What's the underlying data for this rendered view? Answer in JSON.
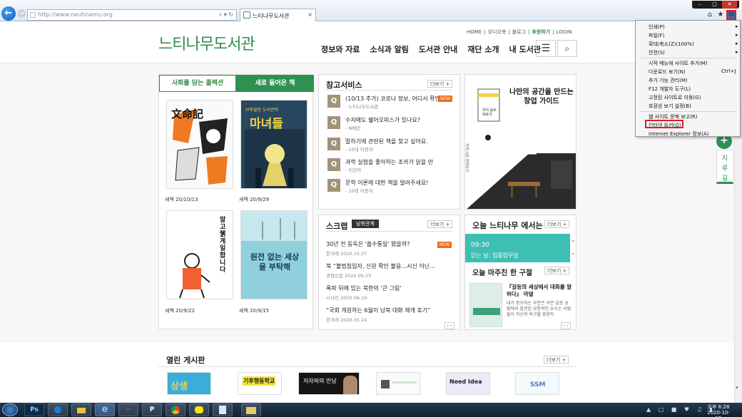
{
  "browser": {
    "url": "http://www.neutinamu.org",
    "address_controls": "⌕ ▾ ↻",
    "tab_title": "느티나무도서관",
    "tab_close": "×",
    "window_controls": {
      "min": "–",
      "max": "□",
      "close": "✕"
    },
    "home_icon": "⌂",
    "star_icon": "★",
    "gear_icon": "⚙"
  },
  "site": {
    "logo": "느티나무도서관",
    "util_links": [
      "HOME",
      "오디오북",
      "블로그",
      "후원하기",
      "LOGIN"
    ],
    "gnb": [
      "정보와 자료",
      "소식과 알림",
      "도서관 안내",
      "재단 소개",
      "내 도서관"
    ],
    "menu_icon": "☰",
    "search_icon": "⌕"
  },
  "books": {
    "tab_collection": "사회를 담는 콜렉션",
    "tab_new": "새로 들어온 책",
    "items": [
      {
        "caption": "새책 20/10/13",
        "cover_text": "文命記"
      },
      {
        "caption": "새책 20/9/29",
        "cover_text": "마녀들",
        "cover_sub": "브루클린 도서관의"
      },
      {
        "caption": "새책 20/9/22",
        "cover_text": "말고 줽게 일합니다"
      },
      {
        "caption": "새책 20/9/15",
        "cover_text": "원전 없는 세상을 부탁해"
      }
    ]
  },
  "reference": {
    "title": "참고서비스",
    "more": "더보기 +",
    "new_badge": "NEW",
    "q_mark": "Q",
    "items": [
      {
        "title": "(10/13 추가) 코로나 정보, 어디서 확인",
        "sub": "- 느티나무도서관"
      },
      {
        "title": "수지에도 쉘어오피스가 있나요?",
        "sub": "- N배런"
      },
      {
        "title": "말하기에 관련된 책을 찾고 싶어요.",
        "sub": "- 10대 이용자"
      },
      {
        "title": "과학 실험을 좋아하는 조카가 읽을 만",
        "sub": "- 이진아"
      },
      {
        "title": "문학 이론에 대한 책을 알려주세요!",
        "sub": "- 20대 이용자"
      }
    ]
  },
  "ad": {
    "title_line1": "나만의 공간을 만드는",
    "title_line2": "창업 가이드",
    "label_left": "지역 시민 얻어보기",
    "label_book": "저자 숨트 북토크"
  },
  "scrap": {
    "title": "스크랩",
    "tag": "남북관계",
    "more": "더보기 +",
    "new_badge": "NEW",
    "items": [
      {
        "title": "30년 전 동독은 '흡수통일' 됐을까?",
        "sub": "한겨레 2020.10.07"
      },
      {
        "title": "북 “불법침입자, 신원 확인 불응…시신 이닌…",
        "sub": "경향신문 2020.09.25"
      },
      {
        "title": "폭파 뒤에 있는 북한의 '큰 그림'",
        "sub": "시사인 2020.06.19"
      },
      {
        "title": "“국회 개원하는 6월이 남북 대화 재개 호기”",
        "sub": "한겨레 2020.05.24"
      }
    ],
    "pager": "‹ ›"
  },
  "today": {
    "title": "오늘 느티나무 에서는",
    "more": "더보기 +",
    "time": "09:30",
    "event": "닫는 날: 집중업무일",
    "phrase_title": "오늘 마주친 한 구절",
    "phrase_more": "더보기 +",
    "book_title": "『갈등의 세상에서 대화를 말하다』 마열",
    "quote": "내가 증오하는 부분은 어떤 갈등 상황에서 발견된 공통적인 요소는 사람들이 자신의 욕구를 표현하",
    "pager": "‹ ›"
  },
  "board": {
    "title": "열린 게시판",
    "more": "더보기 +",
    "thumb_texts": [
      "상생",
      "기후행동학교",
      "저자와의 만남",
      "",
      "Need Idea",
      "SSM"
    ]
  },
  "side": {
    "plus": "+",
    "jiroogil": "지\n루\n길"
  },
  "ie_menu": {
    "items": [
      {
        "label": "인쇄(P)",
        "arrow": "▸"
      },
      {
        "label": "파일(F)",
        "arrow": "▸"
      },
      {
        "label": "확대/축소(Z)(100%)",
        "arrow": "▸"
      },
      {
        "label": "안전(S)",
        "arrow": "▸"
      },
      {
        "label": "시작 메뉴에 사이트 추가(M)"
      },
      {
        "label": "다운로드 보기(N)",
        "shortcut": "Ctrl+J"
      },
      {
        "label": "추가 기능 관리(M)"
      },
      {
        "label": "F12 개발자 도구(L)"
      },
      {
        "label": "고정된 사이트로 이동(G)"
      },
      {
        "label": "호환성 보기 설정(B)"
      },
      {
        "label": "웹 사이트 문제 보고(R)"
      },
      {
        "label": "인터넷 옵션(O)"
      },
      {
        "label": "Internet Explorer 정보(A)"
      }
    ]
  },
  "taskbar": {
    "apps": [
      "Ps",
      "",
      "",
      "e",
      "",
      "P",
      "",
      "",
      "",
      ""
    ],
    "clock_time": "오후 6:28",
    "clock_date": "2020-10-15"
  }
}
